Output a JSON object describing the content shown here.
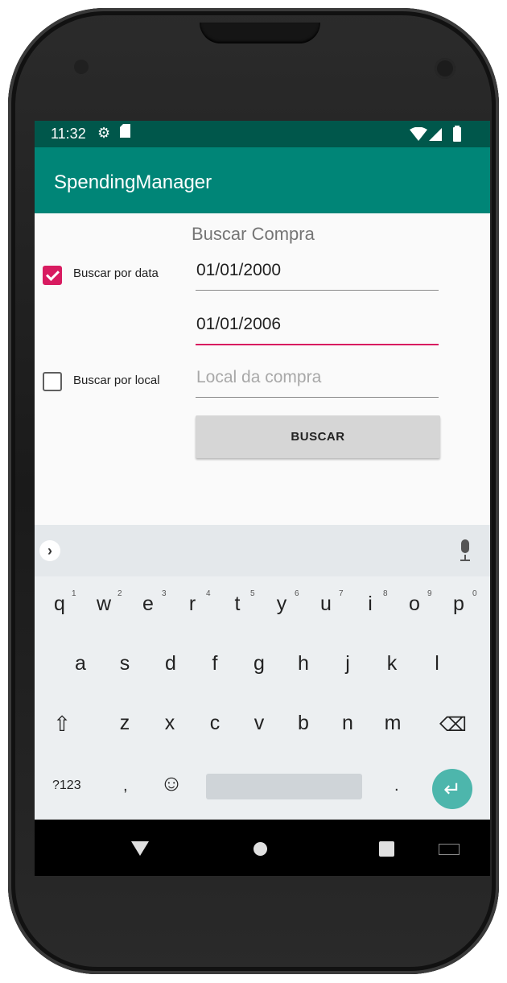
{
  "status_bar": {
    "time": "11:32"
  },
  "app_bar": {
    "title": "SpendingManager"
  },
  "form": {
    "title": "Buscar Compra",
    "date_checkbox": {
      "label": "Buscar por data",
      "checked": true
    },
    "date_from": "01/01/2000",
    "date_to": "01/01/2006",
    "local_checkbox": {
      "label": "Buscar por local",
      "checked": false
    },
    "local_placeholder": "Local da compra",
    "search_button": "BUSCAR"
  },
  "keyboard": {
    "row1": [
      "q",
      "w",
      "e",
      "r",
      "t",
      "y",
      "u",
      "i",
      "o",
      "p"
    ],
    "row1_numbers": [
      "1",
      "2",
      "3",
      "4",
      "5",
      "6",
      "7",
      "8",
      "9",
      "0"
    ],
    "row2": [
      "a",
      "s",
      "d",
      "f",
      "g",
      "h",
      "j",
      "k",
      "l"
    ],
    "row3": [
      "z",
      "x",
      "c",
      "v",
      "b",
      "n",
      "m"
    ],
    "symbols_key": "?123",
    "comma_key": ",",
    "period_key": ".",
    "shift_glyph": "⇧",
    "backspace_glyph": "⌫",
    "emoji_glyph": "☺",
    "enter_glyph": "↵",
    "suggestion_chevron": "›"
  },
  "colors": {
    "primary": "#008577",
    "primary_dark": "#00574b",
    "accent": "#D81B60",
    "enter_key": "#4DB6AC"
  }
}
